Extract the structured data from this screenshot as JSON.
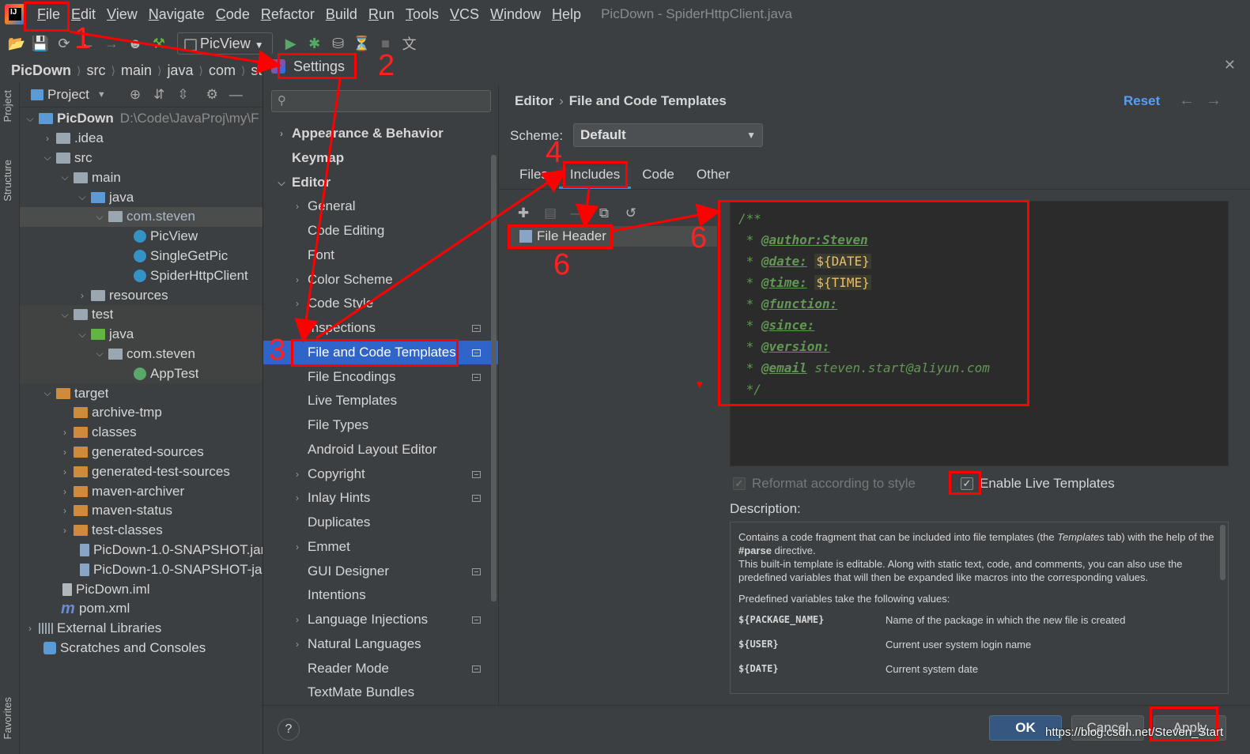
{
  "menubar": {
    "logo_text": "IJ",
    "items": [
      "File",
      "Edit",
      "View",
      "Navigate",
      "Code",
      "Refactor",
      "Build",
      "Run",
      "Tools",
      "VCS",
      "Window",
      "Help"
    ],
    "window_title": "PicDown - SpiderHttpClient.java"
  },
  "toolbar": {
    "run_config": "PicView",
    "icons": [
      "open-icon",
      "save-icon",
      "sync-icon",
      "back-icon",
      "forward-icon",
      "user-icon",
      "build-hammer-icon",
      "run-icon",
      "debug-icon",
      "coverage-icon",
      "profile-icon",
      "stop-icon",
      "translate-icon"
    ]
  },
  "breadcrumb": [
    "PicDown",
    "src",
    "main",
    "java",
    "com",
    "ste"
  ],
  "side_tabs": {
    "project": "Project",
    "structure": "Structure",
    "favorites": "Favorites"
  },
  "project_panel": {
    "title": "Project",
    "tree": [
      {
        "label": "PicDown",
        "extra": "D:\\Code\\JavaProj\\my\\F"
      },
      {
        "label": ".idea"
      },
      {
        "label": "src"
      },
      {
        "label": "main"
      },
      {
        "label": "java"
      },
      {
        "label": "com.steven"
      },
      {
        "label": "PicView"
      },
      {
        "label": "SingleGetPic"
      },
      {
        "label": "SpiderHttpClient"
      },
      {
        "label": "resources"
      },
      {
        "label": "test"
      },
      {
        "label": "java"
      },
      {
        "label": "com.steven"
      },
      {
        "label": "AppTest"
      },
      {
        "label": "target"
      },
      {
        "label": "archive-tmp"
      },
      {
        "label": "classes"
      },
      {
        "label": "generated-sources"
      },
      {
        "label": "generated-test-sources"
      },
      {
        "label": "maven-archiver"
      },
      {
        "label": "maven-status"
      },
      {
        "label": "test-classes"
      },
      {
        "label": "PicDown-1.0-SNAPSHOT.jar"
      },
      {
        "label": "PicDown-1.0-SNAPSHOT-ja"
      },
      {
        "label": "PicDown.iml"
      },
      {
        "label": "pom.xml"
      },
      {
        "label": "External Libraries"
      },
      {
        "label": "Scratches and Consoles"
      }
    ]
  },
  "dialog": {
    "title": "Settings",
    "close": "✕",
    "nav": [
      {
        "label": "Appearance & Behavior"
      },
      {
        "label": "Keymap"
      },
      {
        "label": "Editor"
      },
      {
        "label": "General"
      },
      {
        "label": "Code Editing"
      },
      {
        "label": "Font"
      },
      {
        "label": "Color Scheme"
      },
      {
        "label": "Code Style"
      },
      {
        "label": "Inspections"
      },
      {
        "label": "File and Code Templates"
      },
      {
        "label": "File Encodings"
      },
      {
        "label": "Live Templates"
      },
      {
        "label": "File Types"
      },
      {
        "label": "Android Layout Editor"
      },
      {
        "label": "Copyright"
      },
      {
        "label": "Inlay Hints"
      },
      {
        "label": "Duplicates"
      },
      {
        "label": "Emmet"
      },
      {
        "label": "GUI Designer"
      },
      {
        "label": "Intentions"
      },
      {
        "label": "Language Injections"
      },
      {
        "label": "Natural Languages"
      },
      {
        "label": "Reader Mode"
      },
      {
        "label": "TextMate Bundles"
      }
    ],
    "content": {
      "crumb_parent": "Editor",
      "crumb_sep": "›",
      "crumb_current": "File and Code Templates",
      "reset": "Reset",
      "scheme_label": "Scheme:",
      "scheme_value": "Default",
      "tabs": [
        "Files",
        "Includes",
        "Code",
        "Other"
      ],
      "active_tab": "Includes",
      "template_item": "File Header",
      "code": {
        "open": "/**",
        "star": " * ",
        "author_tag": "@author:",
        "author_val": "Steven",
        "date_tag": "@date:",
        "date_var": "${DATE}",
        "time_tag": "@time:",
        "time_var": "${TIME}",
        "function_tag": "@function:",
        "since_tag": "@since:",
        "version_tag": "@version:",
        "email_tag": "@email",
        "email_val": "steven.start@aliyun.com",
        "close": " */"
      },
      "reformat_label": "Reformat according to style",
      "live_templates_label": "Enable Live Templates",
      "description_label": "Description:",
      "description": {
        "p1_a": "Contains a code fragment that can be included into file templates (the ",
        "p1_italic": "Templates",
        "p1_b": " tab) with the help of the ",
        "p1_bold": "#parse",
        "p1_c": " directive.",
        "p2": "This built-in template is editable. Along with static text, code, and comments, you can also use the predefined variables that will then be expanded like macros into the corresponding values.",
        "p3": "Predefined variables take the following values:",
        "vars": [
          {
            "name": "${PACKAGE_NAME}",
            "desc": "Name of the package in which the new file is created"
          },
          {
            "name": "${USER}",
            "desc": "Current user system login name"
          },
          {
            "name": "${DATE}",
            "desc": "Current system date"
          }
        ]
      }
    },
    "footer": {
      "help": "?",
      "ok": "OK",
      "cancel": "Cancel",
      "apply": "Apply"
    }
  },
  "annotations": {
    "n1": "1",
    "n2": "2",
    "n3": "3",
    "n4": "4",
    "n6a": "6",
    "n6b": "6",
    "color": "#ff0000"
  },
  "watermark": "https://blog.csdn.net/Steven_Start"
}
